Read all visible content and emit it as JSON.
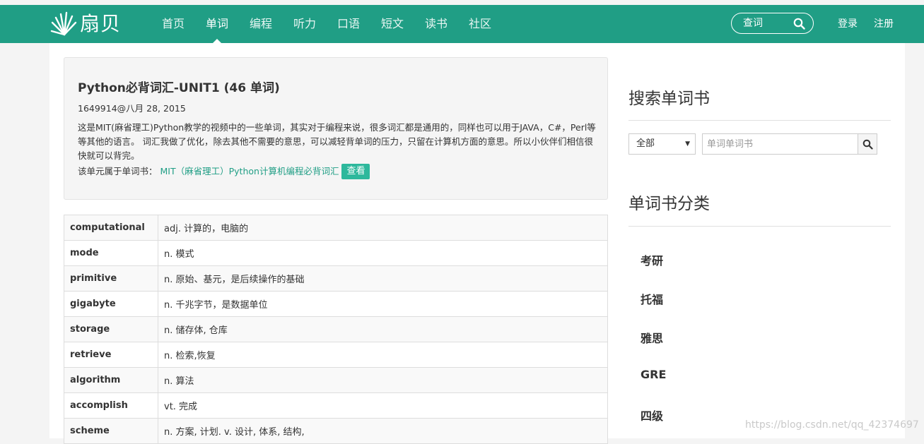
{
  "header": {
    "logo_text": "扇贝",
    "nav": [
      {
        "label": "首页",
        "active": false
      },
      {
        "label": "单词",
        "active": true
      },
      {
        "label": "编程",
        "active": false
      },
      {
        "label": "听力",
        "active": false
      },
      {
        "label": "口语",
        "active": false
      },
      {
        "label": "短文",
        "active": false
      },
      {
        "label": "读书",
        "active": false
      },
      {
        "label": "社区",
        "active": false
      }
    ],
    "search_label": "查词",
    "login": "登录",
    "register": "注册",
    "brand_color": "#209e85"
  },
  "unit": {
    "title": "Python必背词汇-UNIT1 (46 单词)",
    "meta": "1649914@八月 28, 2015",
    "description": "这是MIT(麻省理工)Python教学的视频中的一些单词，其实对于编程来说，很多词汇都是通用的，同样也可以用于JAVA，C#，Perl等等其他的语言。 词汇我做了优化，除去其他不需要的意思，可以减轻背单词的压力，只留在计算机方面的意思。所以小伙伴们相信很快就可以背完。",
    "belongs_label": "该单元属于单词书：",
    "book_name": "MIT（麻省理工）Python计算机编程必背词汇",
    "view_button": "查看"
  },
  "words": [
    {
      "word": "computational",
      "meaning": "adj. 计算的，电脑的"
    },
    {
      "word": "mode",
      "meaning": "n. 模式"
    },
    {
      "word": "primitive",
      "meaning": "n. 原始、基元，是后续操作的基础"
    },
    {
      "word": "gigabyte",
      "meaning": "n. 千兆字节，是数据单位"
    },
    {
      "word": "storage",
      "meaning": "n. 储存体, 仓库"
    },
    {
      "word": "retrieve",
      "meaning": "n. 检索,恢复"
    },
    {
      "word": "algorithm",
      "meaning": "n. 算法"
    },
    {
      "word": "accomplish",
      "meaning": "vt. 完成"
    },
    {
      "word": "scheme",
      "meaning": "n. 方案, 计划. v. 设计, 体系, 结构,"
    }
  ],
  "sidebar": {
    "search_heading": "搜索单词书",
    "scope_value": "全部",
    "book_search_placeholder": "单词单词书",
    "category_heading": "单词书分类",
    "categories": [
      "考研",
      "托福",
      "雅思",
      "GRE",
      "四级"
    ]
  },
  "watermark": "https://blog.csdn.net/qq_42374697"
}
